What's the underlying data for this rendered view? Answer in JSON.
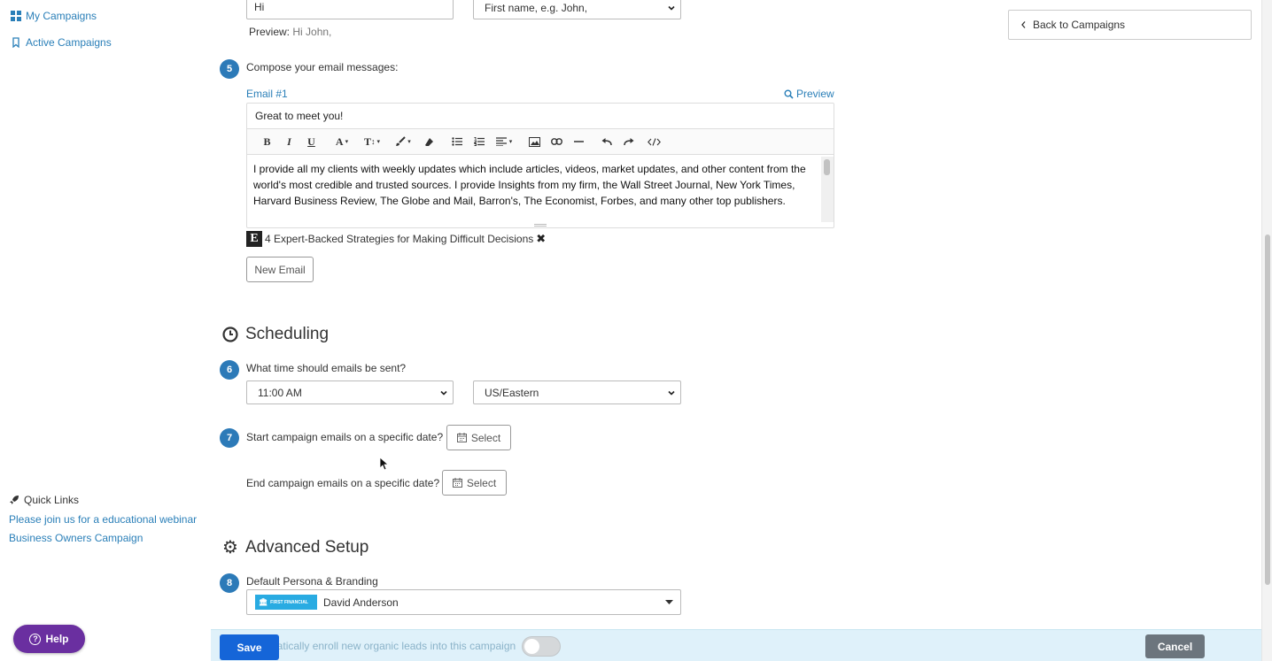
{
  "sidebar": {
    "nav": [
      {
        "label": "My Campaigns",
        "icon": "grid-icon"
      },
      {
        "label": "Active Campaigns",
        "icon": "bookmark-icon"
      }
    ],
    "quick_links": {
      "title": "Quick Links",
      "links": [
        "Please join us for a educational webinar",
        "Business Owners Campaign"
      ]
    },
    "help_label": "Help"
  },
  "greeting": {
    "value": "Hi",
    "name_select": "First name, e.g. John,",
    "preview_label": "Preview:",
    "preview_text": "Hi John,"
  },
  "back_button": "Back to Campaigns",
  "step5": {
    "number": "5",
    "label": "Compose your email messages:",
    "email_title": "Email #1",
    "preview_link": "Preview",
    "subject": "Great to meet you!",
    "body": "I provide all my clients with weekly updates which include articles, videos, market updates, and other content from the world's most credible and trusted sources. I provide Insights from my firm, the Wall Street Journal, New York Times, Harvard Business Review, The Globe and Mail, Barron's, The Economist, Forbes, and many other top publishers.",
    "attachment_badge": "E",
    "attachment": "4 Expert-Backed Strategies for Making Difficult Decisions",
    "new_email": "New Email"
  },
  "scheduling": {
    "title": "Scheduling",
    "step6": {
      "number": "6",
      "label": "What time should emails be sent?",
      "time": "11:00 AM",
      "timezone": "US/Eastern"
    },
    "step7": {
      "number": "7",
      "label": "Start campaign emails on a specific date?",
      "select": "Select"
    },
    "end": {
      "label": "End campaign emails on a specific date?",
      "select": "Select"
    }
  },
  "advanced": {
    "title": "Advanced Setup",
    "step8": {
      "number": "8",
      "label": "Default Persona & Branding",
      "brand_logo_text": "FIRST FINANCIAL",
      "persona": "David Anderson"
    }
  },
  "bottom": {
    "save": "Save",
    "auto_enroll": "Automatically enroll new organic leads into this campaign",
    "cancel": "Cancel"
  },
  "colors": {
    "accent": "#2c7ab8",
    "save": "#1565d8",
    "help": "#6a2fa0",
    "cancel": "#6c757d",
    "brand": "#29abe2"
  }
}
